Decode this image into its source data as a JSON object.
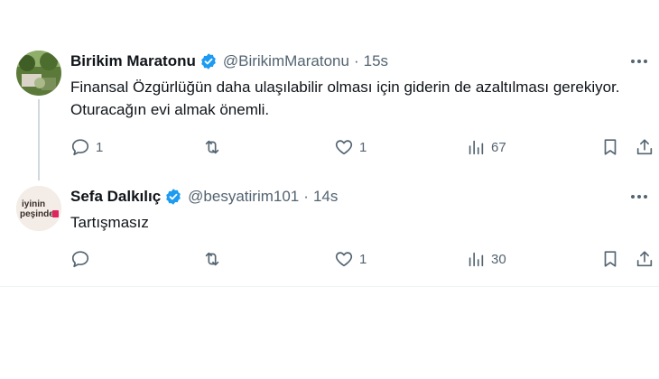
{
  "tweets": [
    {
      "author_name": "Birikim Maratonu",
      "handle": "@BirikimMaratonu",
      "separator": "·",
      "time": "15s",
      "text": "Finansal Özgürlüğün daha ulaşılabilir olması için giderin de azaltılması gerekiyor. Oturacağın evi almak önemli.",
      "replies": "1",
      "retweets": "",
      "likes": "1",
      "views": "67",
      "avatar_icon": "landscape-avatar"
    },
    {
      "author_name": "Sefa Dalkılıç",
      "handle": "@besyatirim101",
      "separator": "·",
      "time": "14s",
      "text": "Tartışmasız",
      "replies": "",
      "retweets": "",
      "likes": "1",
      "views": "30",
      "avatar_text_1": "iyinin",
      "avatar_text_2": "peşinde"
    }
  ],
  "colors": {
    "verified": "#1d9bf0",
    "secondary_text": "#536471",
    "primary_text": "#0f1419",
    "thread_line": "#cfd9de",
    "avatar_accent": "#e0245e"
  },
  "icons": [
    "reply-icon",
    "retweet-icon",
    "like-icon",
    "views-icon",
    "bookmark-icon",
    "share-icon",
    "more-icon",
    "verified-badge-icon"
  ]
}
